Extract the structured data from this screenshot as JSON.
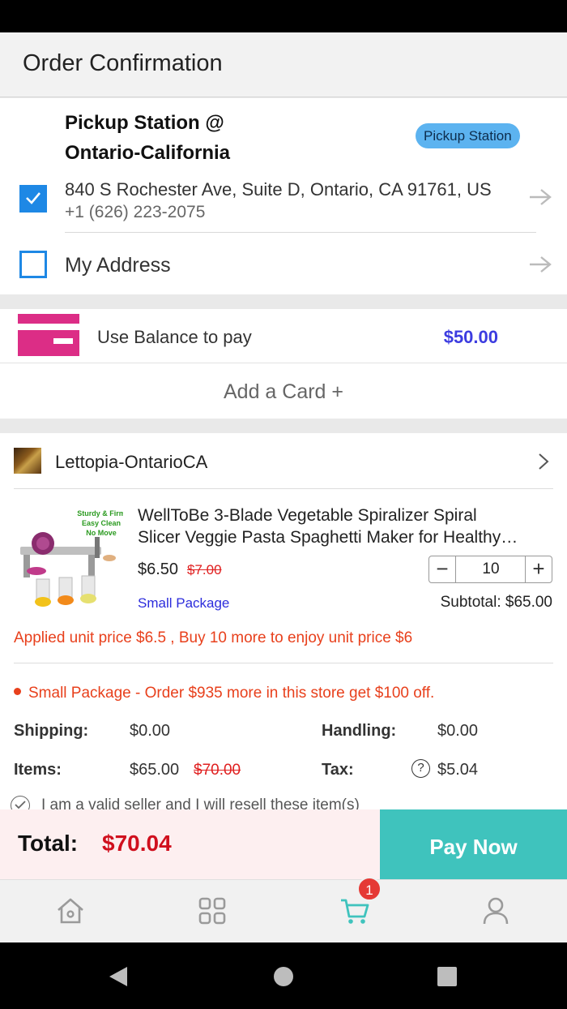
{
  "header": {
    "title": "Order Confirmation"
  },
  "addresses": {
    "pickup": {
      "name_line1": "Pickup Station @",
      "name_line2": "Ontario-California",
      "badge": "Pickup Station",
      "address": "840 S Rochester Ave, Suite D, Ontario, CA 91761, US",
      "phone": "+1 (626) 223-2075",
      "checked": true
    },
    "my_address": {
      "label": "My Address",
      "checked": false
    }
  },
  "payment": {
    "balance_label": "Use Balance to pay",
    "balance_amount": "$50.00",
    "add_card_label": "Add a Card +"
  },
  "store": {
    "name": "Lettopia-OntarioCA",
    "product": {
      "image_caption": [
        "Sturdy & Firm",
        "Easy Clean",
        "No Move"
      ],
      "title_line1": "WellToBe 3-Blade Vegetable Spiralizer Spiral",
      "title_line2": "Slicer Veggie Pasta Spaghetti Maker for Healthy…",
      "price": "$6.50",
      "old_price": "$7.00",
      "quantity": "10",
      "package_link": "Small Package",
      "subtotal": "Subtotal: $65.00"
    },
    "promo": "Applied unit price $6.5 , Buy 10 more to enjoy unit price $6",
    "package_notice": "Small Package - Order $935 more in this store get $100 off.",
    "fees": {
      "shipping_label": "Shipping:",
      "shipping_value": "$0.00",
      "handling_label": "Handling:",
      "handling_value": "$0.00",
      "items_label": "Items:",
      "items_value": "$65.00",
      "items_old": "$70.00",
      "tax_label": "Tax:",
      "tax_value": "$5.04"
    },
    "seller_notice": "I am a valid seller and I will resell these item(s)"
  },
  "checkout": {
    "total_label": "Total:",
    "total_amount": "$70.04",
    "pay_button": "Pay Now"
  },
  "tabbar": {
    "items": [
      "home-icon",
      "grid-icon",
      "cart-icon",
      "profile-icon"
    ],
    "cart_badge": "1",
    "active": "cart-icon"
  },
  "colors": {
    "accent_blue": "#1e88e5",
    "teal": "#3fc3bd",
    "total_red": "#d0101e",
    "promo_orange": "#e8401c",
    "card_pink": "#dc2d86"
  }
}
